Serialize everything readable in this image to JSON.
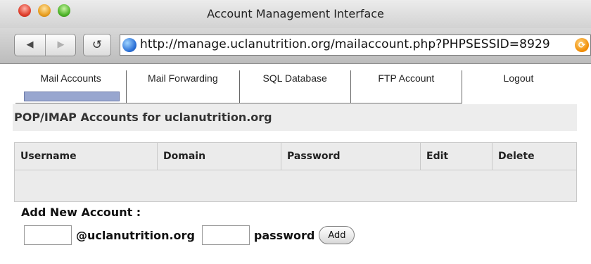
{
  "window": {
    "title": "Account Management Interface"
  },
  "toolbar": {
    "back_glyph": "◀",
    "forward_glyph": "▶",
    "reload_glyph": "↺",
    "url": "http://manage.uclanutrition.org/mailaccount.php?PHPSESSID=8929",
    "rss_glyph": "⟳"
  },
  "nav": {
    "active_index": 0,
    "items": [
      {
        "label": "Mail Accounts"
      },
      {
        "label": "Mail Forwarding"
      },
      {
        "label": "SQL Database"
      },
      {
        "label": "FTP Account"
      },
      {
        "label": "Logout"
      }
    ]
  },
  "section": {
    "heading": "POP/IMAP Accounts for uclanutrition.org"
  },
  "accounts_table": {
    "columns": [
      "Username",
      "Domain",
      "Password",
      "Edit",
      "Delete"
    ],
    "rows": []
  },
  "add_account": {
    "title": "Add New Account :",
    "domain_label": "@uclanutrition.org",
    "password_label": "password",
    "username_value": "",
    "password_value": "",
    "button_label": "Add"
  },
  "colors": {
    "active_tab_bar": "#98a6cf",
    "heading_bg": "#ededed",
    "table_bg": "#ebebeb"
  }
}
